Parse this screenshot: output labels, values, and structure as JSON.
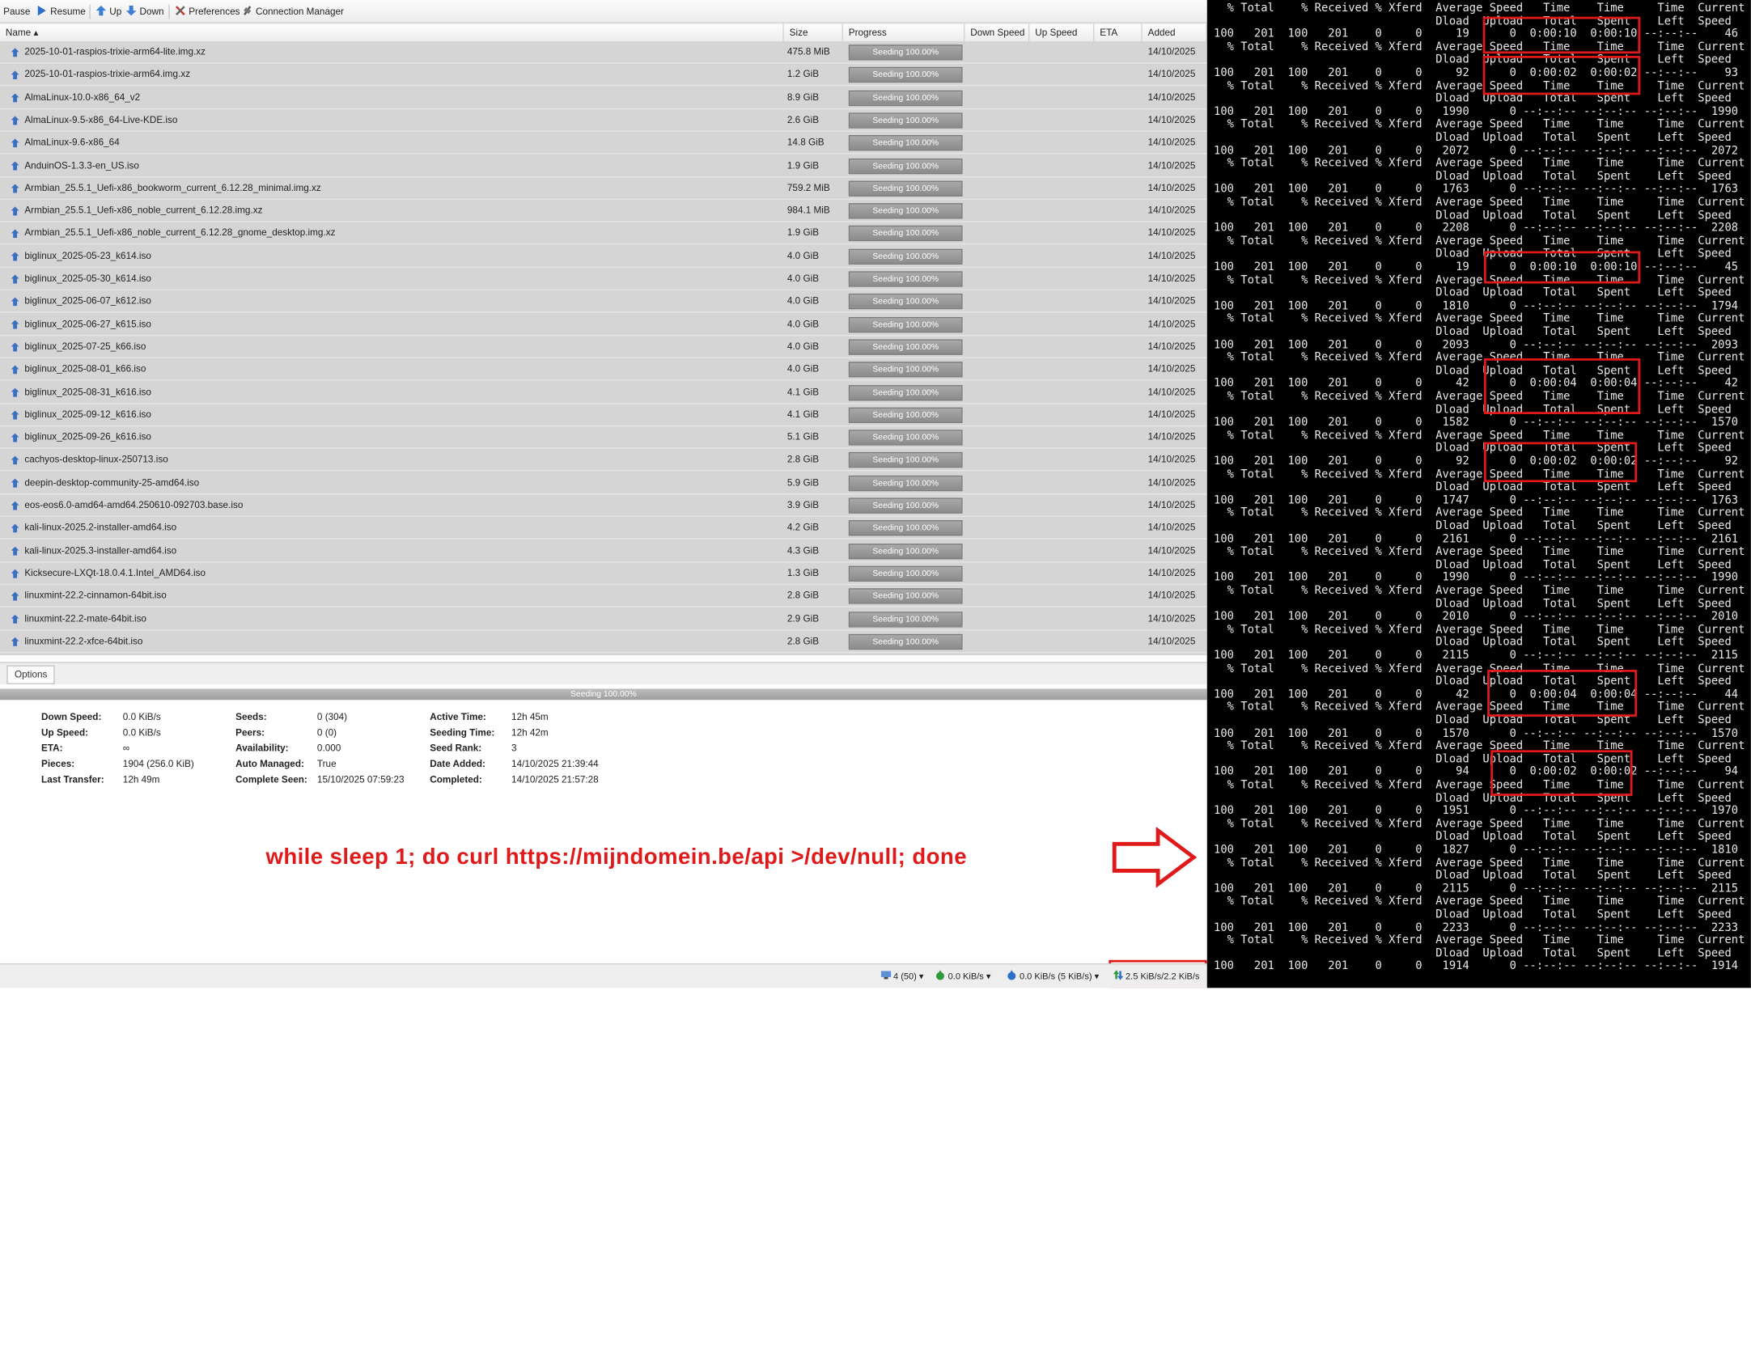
{
  "toolbar": {
    "pause": "Pause",
    "resume": "Resume",
    "up": "Up",
    "down": "Down",
    "preferences": "Preferences",
    "connection_manager": "Connection Manager"
  },
  "columns": {
    "name": "Name ▴",
    "size": "Size",
    "progress": "Progress",
    "down_speed": "Down Speed",
    "up_speed": "Up Speed",
    "eta": "ETA",
    "added": "Added"
  },
  "torrents": [
    {
      "name": "2025-10-01-raspios-trixie-arm64-lite.img.xz",
      "size": "475.8 MiB",
      "progress": "Seeding 100.00%",
      "added": "14/10/2025"
    },
    {
      "name": "2025-10-01-raspios-trixie-arm64.img.xz",
      "size": "1.2 GiB",
      "progress": "Seeding 100.00%",
      "added": "14/10/2025"
    },
    {
      "name": "AlmaLinux-10.0-x86_64_v2",
      "size": "8.9 GiB",
      "progress": "Seeding 100.00%",
      "added": "14/10/2025"
    },
    {
      "name": "AlmaLinux-9.5-x86_64-Live-KDE.iso",
      "size": "2.6 GiB",
      "progress": "Seeding 100.00%",
      "added": "14/10/2025"
    },
    {
      "name": "AlmaLinux-9.6-x86_64",
      "size": "14.8 GiB",
      "progress": "Seeding 100.00%",
      "added": "14/10/2025"
    },
    {
      "name": "AnduinOS-1.3.3-en_US.iso",
      "size": "1.9 GiB",
      "progress": "Seeding 100.00%",
      "added": "14/10/2025"
    },
    {
      "name": "Armbian_25.5.1_Uefi-x86_bookworm_current_6.12.28_minimal.img.xz",
      "size": "759.2 MiB",
      "progress": "Seeding 100.00%",
      "added": "14/10/2025"
    },
    {
      "name": "Armbian_25.5.1_Uefi-x86_noble_current_6.12.28.img.xz",
      "size": "984.1 MiB",
      "progress": "Seeding 100.00%",
      "added": "14/10/2025"
    },
    {
      "name": "Armbian_25.5.1_Uefi-x86_noble_current_6.12.28_gnome_desktop.img.xz",
      "size": "1.9 GiB",
      "progress": "Seeding 100.00%",
      "added": "14/10/2025"
    },
    {
      "name": "biglinux_2025-05-23_k614.iso",
      "size": "4.0 GiB",
      "progress": "Seeding 100.00%",
      "added": "14/10/2025"
    },
    {
      "name": "biglinux_2025-05-30_k614.iso",
      "size": "4.0 GiB",
      "progress": "Seeding 100.00%",
      "added": "14/10/2025"
    },
    {
      "name": "biglinux_2025-06-07_k612.iso",
      "size": "4.0 GiB",
      "progress": "Seeding 100.00%",
      "added": "14/10/2025"
    },
    {
      "name": "biglinux_2025-06-27_k615.iso",
      "size": "4.0 GiB",
      "progress": "Seeding 100.00%",
      "added": "14/10/2025"
    },
    {
      "name": "biglinux_2025-07-25_k66.iso",
      "size": "4.0 GiB",
      "progress": "Seeding 100.00%",
      "added": "14/10/2025"
    },
    {
      "name": "biglinux_2025-08-01_k66.iso",
      "size": "4.0 GiB",
      "progress": "Seeding 100.00%",
      "added": "14/10/2025"
    },
    {
      "name": "biglinux_2025-08-31_k616.iso",
      "size": "4.1 GiB",
      "progress": "Seeding 100.00%",
      "added": "14/10/2025"
    },
    {
      "name": "biglinux_2025-09-12_k616.iso",
      "size": "4.1 GiB",
      "progress": "Seeding 100.00%",
      "added": "14/10/2025"
    },
    {
      "name": "biglinux_2025-09-26_k616.iso",
      "size": "5.1 GiB",
      "progress": "Seeding 100.00%",
      "added": "14/10/2025"
    },
    {
      "name": "cachyos-desktop-linux-250713.iso",
      "size": "2.8 GiB",
      "progress": "Seeding 100.00%",
      "added": "14/10/2025"
    },
    {
      "name": "deepin-desktop-community-25-amd64.iso",
      "size": "5.9 GiB",
      "progress": "Seeding 100.00%",
      "added": "14/10/2025"
    },
    {
      "name": "eos-eos6.0-amd64-amd64.250610-092703.base.iso",
      "size": "3.9 GiB",
      "progress": "Seeding 100.00%",
      "added": "14/10/2025"
    },
    {
      "name": "kali-linux-2025.2-installer-amd64.iso",
      "size": "4.2 GiB",
      "progress": "Seeding 100.00%",
      "added": "14/10/2025"
    },
    {
      "name": "kali-linux-2025.3-installer-amd64.iso",
      "size": "4.3 GiB",
      "progress": "Seeding 100.00%",
      "added": "14/10/2025"
    },
    {
      "name": "Kicksecure-LXQt-18.0.4.1.Intel_AMD64.iso",
      "size": "1.3 GiB",
      "progress": "Seeding 100.00%",
      "added": "14/10/2025"
    },
    {
      "name": "linuxmint-22.2-cinnamon-64bit.iso",
      "size": "2.8 GiB",
      "progress": "Seeding 100.00%",
      "added": "14/10/2025"
    },
    {
      "name": "linuxmint-22.2-mate-64bit.iso",
      "size": "2.9 GiB",
      "progress": "Seeding 100.00%",
      "added": "14/10/2025"
    },
    {
      "name": "linuxmint-22.2-xfce-64bit.iso",
      "size": "2.8 GiB",
      "progress": "Seeding 100.00%",
      "added": "14/10/2025"
    }
  ],
  "tabs": {
    "options": "Options"
  },
  "details_bar": "Seeding 100.00%",
  "details": {
    "col1": [
      {
        "label": "Down Speed:",
        "value": "0.0 KiB/s"
      },
      {
        "label": "Up Speed:",
        "value": "0.0 KiB/s"
      },
      {
        "label": "ETA:",
        "value": "∞"
      },
      {
        "label": "Pieces:",
        "value": "1904 (256.0 KiB)"
      },
      {
        "label": "Last Transfer:",
        "value": "12h 49m"
      }
    ],
    "col2": [
      {
        "label": "Seeds:",
        "value": "0 (304)"
      },
      {
        "label": "Peers:",
        "value": "0 (0)"
      },
      {
        "label": "Availability:",
        "value": "0.000"
      },
      {
        "label": "Auto Managed:",
        "value": "True"
      },
      {
        "label": "Complete Seen:",
        "value": "15/10/2025 07:59:23"
      }
    ],
    "col3": [
      {
        "label": "Active Time:",
        "value": "12h 45m"
      },
      {
        "label": "Seeding Time:",
        "value": "12h 42m"
      },
      {
        "label": "Seed Rank:",
        "value": "3"
      },
      {
        "label": "Date Added:",
        "value": "14/10/2025 21:39:44"
      },
      {
        "label": "Completed:",
        "value": "14/10/2025 21:57:28"
      }
    ]
  },
  "statusbar": {
    "connections": "4 (50)",
    "down": "0.0 KiB/s",
    "up": "0.0 KiB/s (5 KiB/s)",
    "traffic": "2.5 KiB/s/2.2 KiB/s"
  },
  "annotation": "while sleep 1; do curl https://mijndomein.be/api >/dev/null; done",
  "terminal_lines": [
    "  % Total    % Received % Xferd  Average Speed   Time    Time     Time  Current",
    "                                 Dload  Upload   Total   Spent    Left  Speed",
    "100   201  100   201    0     0     19      0  0:00:10  0:00:10 --:--:--    46",
    "  % Total    % Received % Xferd  Average Speed   Time    Time     Time  Current",
    "                                 Dload  Upload   Total   Spent    Left  Speed",
    "100   201  100   201    0     0     92      0  0:00:02  0:00:02 --:--:--    93",
    "  % Total    % Received % Xferd  Average Speed   Time    Time     Time  Current",
    "                                 Dload  Upload   Total   Spent    Left  Speed",
    "100   201  100   201    0     0   1990      0 --:--:-- --:--:-- --:--:--  1990",
    "  % Total    % Received % Xferd  Average Speed   Time    Time     Time  Current",
    "                                 Dload  Upload   Total   Spent    Left  Speed",
    "100   201  100   201    0     0   2072      0 --:--:-- --:--:-- --:--:--  2072",
    "  % Total    % Received % Xferd  Average Speed   Time    Time     Time  Current",
    "                                 Dload  Upload   Total   Spent    Left  Speed",
    "100   201  100   201    0     0   1763      0 --:--:-- --:--:-- --:--:--  1763",
    "  % Total    % Received % Xferd  Average Speed   Time    Time     Time  Current",
    "                                 Dload  Upload   Total   Spent    Left  Speed",
    "100   201  100   201    0     0   2208      0 --:--:-- --:--:-- --:--:--  2208",
    "  % Total    % Received % Xferd  Average Speed   Time    Time     Time  Current",
    "                                 Dload  Upload   Total   Spent    Left  Speed",
    "100   201  100   201    0     0     19      0  0:00:10  0:00:10 --:--:--    45",
    "  % Total    % Received % Xferd  Average Speed   Time    Time     Time  Current",
    "                                 Dload  Upload   Total   Spent    Left  Speed",
    "100   201  100   201    0     0   1810      0 --:--:-- --:--:-- --:--:--  1794",
    "  % Total    % Received % Xferd  Average Speed   Time    Time     Time  Current",
    "                                 Dload  Upload   Total   Spent    Left  Speed",
    "100   201  100   201    0     0   2093      0 --:--:-- --:--:-- --:--:--  2093",
    "  % Total    % Received % Xferd  Average Speed   Time    Time     Time  Current",
    "                                 Dload  Upload   Total   Spent    Left  Speed",
    "100   201  100   201    0     0     42      0  0:00:04  0:00:04 --:--:--    42",
    "  % Total    % Received % Xferd  Average Speed   Time    Time     Time  Current",
    "                                 Dload  Upload   Total   Spent    Left  Speed",
    "100   201  100   201    0     0   1582      0 --:--:-- --:--:-- --:--:--  1570",
    "  % Total    % Received % Xferd  Average Speed   Time    Time     Time  Current",
    "                                 Dload  Upload   Total   Spent    Left  Speed",
    "100   201  100   201    0     0     92      0  0:00:02  0:00:02 --:--:--    92",
    "  % Total    % Received % Xferd  Average Speed   Time    Time     Time  Current",
    "                                 Dload  Upload   Total   Spent    Left  Speed",
    "100   201  100   201    0     0   1747      0 --:--:-- --:--:-- --:--:--  1763",
    "  % Total    % Received % Xferd  Average Speed   Time    Time     Time  Current",
    "                                 Dload  Upload   Total   Spent    Left  Speed",
    "100   201  100   201    0     0   2161      0 --:--:-- --:--:-- --:--:--  2161",
    "  % Total    % Received % Xferd  Average Speed   Time    Time     Time  Current",
    "                                 Dload  Upload   Total   Spent    Left  Speed",
    "100   201  100   201    0     0   1990      0 --:--:-- --:--:-- --:--:--  1990",
    "  % Total    % Received % Xferd  Average Speed   Time    Time     Time  Current",
    "                                 Dload  Upload   Total   Spent    Left  Speed",
    "100   201  100   201    0     0   2010      0 --:--:-- --:--:-- --:--:--  2010",
    "  % Total    % Received % Xferd  Average Speed   Time    Time     Time  Current",
    "                                 Dload  Upload   Total   Spent    Left  Speed",
    "100   201  100   201    0     0   2115      0 --:--:-- --:--:-- --:--:--  2115",
    "  % Total    % Received % Xferd  Average Speed   Time    Time     Time  Current",
    "                                 Dload  Upload   Total   Spent    Left  Speed",
    "100   201  100   201    0     0     42      0  0:00:04  0:00:04 --:--:--    44",
    "  % Total    % Received % Xferd  Average Speed   Time    Time     Time  Current",
    "                                 Dload  Upload   Total   Spent    Left  Speed",
    "100   201  100   201    0     0   1570      0 --:--:-- --:--:-- --:--:--  1570",
    "  % Total    % Received % Xferd  Average Speed   Time    Time     Time  Current",
    "                                 Dload  Upload   Total   Spent    Left  Speed",
    "100   201  100   201    0     0     94      0  0:00:02  0:00:02 --:--:--    94",
    "  % Total    % Received % Xferd  Average Speed   Time    Time     Time  Current",
    "                                 Dload  Upload   Total   Spent    Left  Speed",
    "100   201  100   201    0     0   1951      0 --:--:-- --:--:-- --:--:--  1970",
    "  % Total    % Received % Xferd  Average Speed   Time    Time     Time  Current",
    "                                 Dload  Upload   Total   Spent    Left  Speed",
    "100   201  100   201    0     0   1827      0 --:--:-- --:--:-- --:--:--  1810",
    "  % Total    % Received % Xferd  Average Speed   Time    Time     Time  Current",
    "                                 Dload  Upload   Total   Spent    Left  Speed",
    "100   201  100   201    0     0   2115      0 --:--:-- --:--:-- --:--:--  2115",
    "  % Total    % Received % Xferd  Average Speed   Time    Time     Time  Current",
    "                                 Dload  Upload   Total   Spent    Left  Speed",
    "100   201  100   201    0     0   2233      0 --:--:-- --:--:-- --:--:--  2233",
    "  % Total    % Received % Xferd  Average Speed   Time    Time     Time  Current",
    "                                 Dload  Upload   Total   Spent    Left  Speed",
    "100   201  100   201    0     0   1914      0 --:--:-- --:--:-- --:--:--  1914"
  ]
}
